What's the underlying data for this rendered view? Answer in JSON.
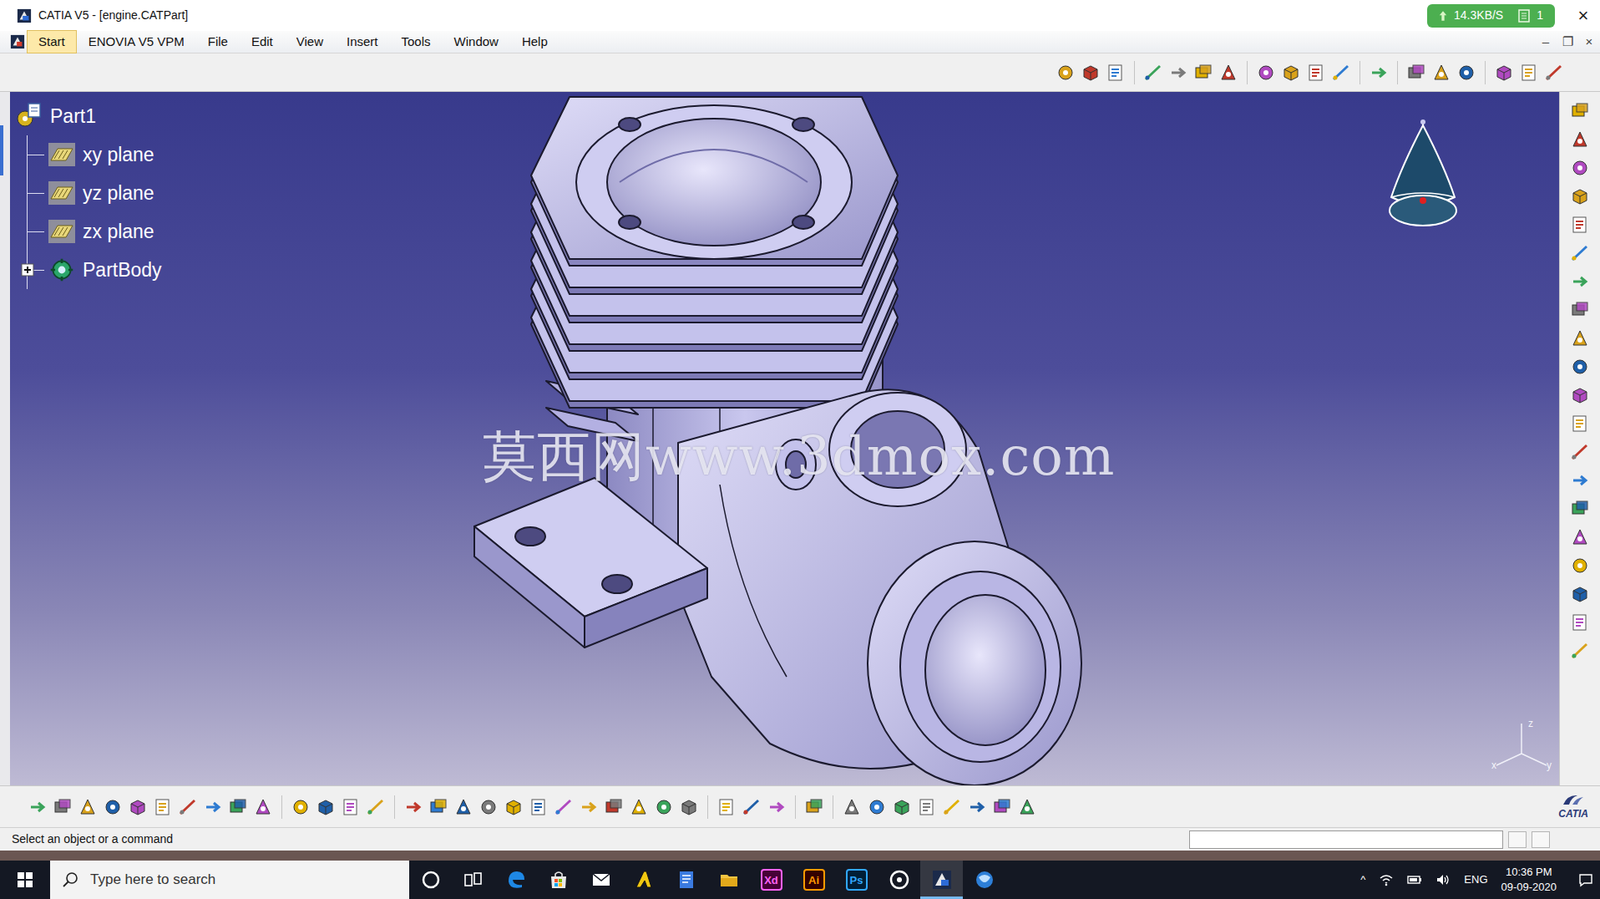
{
  "window": {
    "title": "CATIA V5 - [engine.CATPart]",
    "net_speed": "14.3KB/S",
    "net_count": "1",
    "close": "×"
  },
  "menu": [
    {
      "label": "Start",
      "selected": true
    },
    {
      "label": "ENOVIA V5 VPM",
      "selected": false
    },
    {
      "label": "File",
      "selected": false
    },
    {
      "label": "Edit",
      "selected": false
    },
    {
      "label": "View",
      "selected": false
    },
    {
      "label": "Insert",
      "selected": false
    },
    {
      "label": "Tools",
      "selected": false
    },
    {
      "label": "Window",
      "selected": false
    },
    {
      "label": "Help",
      "selected": false
    }
  ],
  "doc_controls": [
    "–",
    "❐",
    "×"
  ],
  "tree": {
    "root": {
      "label": "Part1",
      "expanded": true
    },
    "children": [
      {
        "label": "xy plane",
        "kind": "plane"
      },
      {
        "label": "yz plane",
        "kind": "plane"
      },
      {
        "label": "zx plane",
        "kind": "plane"
      },
      {
        "label": "PartBody",
        "kind": "body",
        "expanded": false
      }
    ]
  },
  "watermark": "莫西网www.3dmox.com",
  "axis": {
    "z": "z",
    "x": "x",
    "y": "y"
  },
  "brand": "CATIA",
  "status": {
    "message": "Select an object or a command"
  },
  "taskbar": {
    "search_placeholder": "Type here to search",
    "apps": [
      {
        "kind": "cortana",
        "selected": false
      },
      {
        "kind": "taskview",
        "selected": false
      },
      {
        "kind": "edge",
        "selected": false
      },
      {
        "kind": "store",
        "selected": false
      },
      {
        "kind": "mail",
        "selected": false
      },
      {
        "kind": "autodesk",
        "selected": false
      },
      {
        "kind": "notes",
        "selected": false
      },
      {
        "kind": "explorer",
        "selected": false
      },
      {
        "kind": "xd",
        "label": "Xd",
        "color": "#ff61f6",
        "selected": false
      },
      {
        "kind": "ai",
        "label": "Ai",
        "color": "#ff9a00",
        "selected": false
      },
      {
        "kind": "ps",
        "label": "Ps",
        "color": "#31a8ff",
        "selected": false
      },
      {
        "kind": "media",
        "selected": false
      },
      {
        "kind": "catia",
        "selected": true
      },
      {
        "kind": "browser",
        "selected": false
      }
    ],
    "tray_caret": "^",
    "language": "ENG",
    "time": "10:36 PM",
    "date": "09-09-2020"
  }
}
